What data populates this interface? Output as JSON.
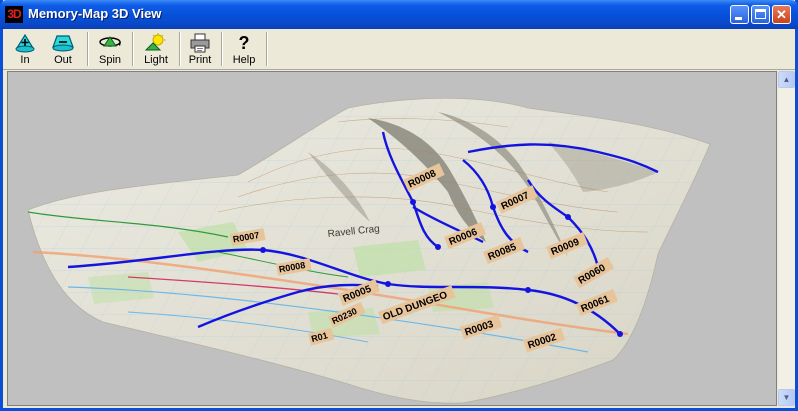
{
  "window": {
    "icon_text": "3D",
    "title": "Memory-Map 3D View"
  },
  "toolbar": {
    "buttons": [
      {
        "label": "In",
        "icon": "zoom-in-icon"
      },
      {
        "label": "Out",
        "icon": "zoom-out-icon"
      },
      {
        "label": "Spin",
        "icon": "spin-icon"
      },
      {
        "label": "Light",
        "icon": "light-icon"
      },
      {
        "label": "Print",
        "icon": "printer-icon"
      },
      {
        "label": "Help",
        "icon": "help-icon"
      }
    ]
  },
  "map": {
    "route_labels": [
      "R0008",
      "R0007",
      "R0006",
      "R0085",
      "R0009",
      "R0060",
      "R0061",
      "R0005",
      "R0003",
      "R0002",
      "R0007",
      "R0008",
      "R0230",
      "OLD DUNGEO",
      "R01"
    ],
    "place_labels": [
      "Ravell Crag"
    ],
    "colors": {
      "route_blue": "#1414e0",
      "label_tan": "#e8c49a",
      "terrain_light": "#e9e6d8",
      "terrain_shadow": "#8f8c80",
      "field_green": "#bfe0a8",
      "background": "#c0c0c0"
    }
  }
}
